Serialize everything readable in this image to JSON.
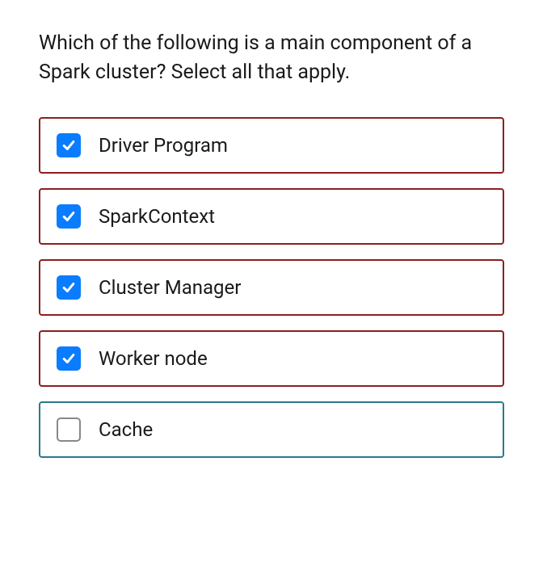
{
  "question": {
    "text": "Which of the following is a main component of a Spark cluster? Select all that apply."
  },
  "options": [
    {
      "label": "Driver Program",
      "checked": true
    },
    {
      "label": "SparkContext",
      "checked": true
    },
    {
      "label": "Cluster Manager",
      "checked": true
    },
    {
      "label": "Worker node",
      "checked": true
    },
    {
      "label": "Cache",
      "checked": false
    }
  ]
}
